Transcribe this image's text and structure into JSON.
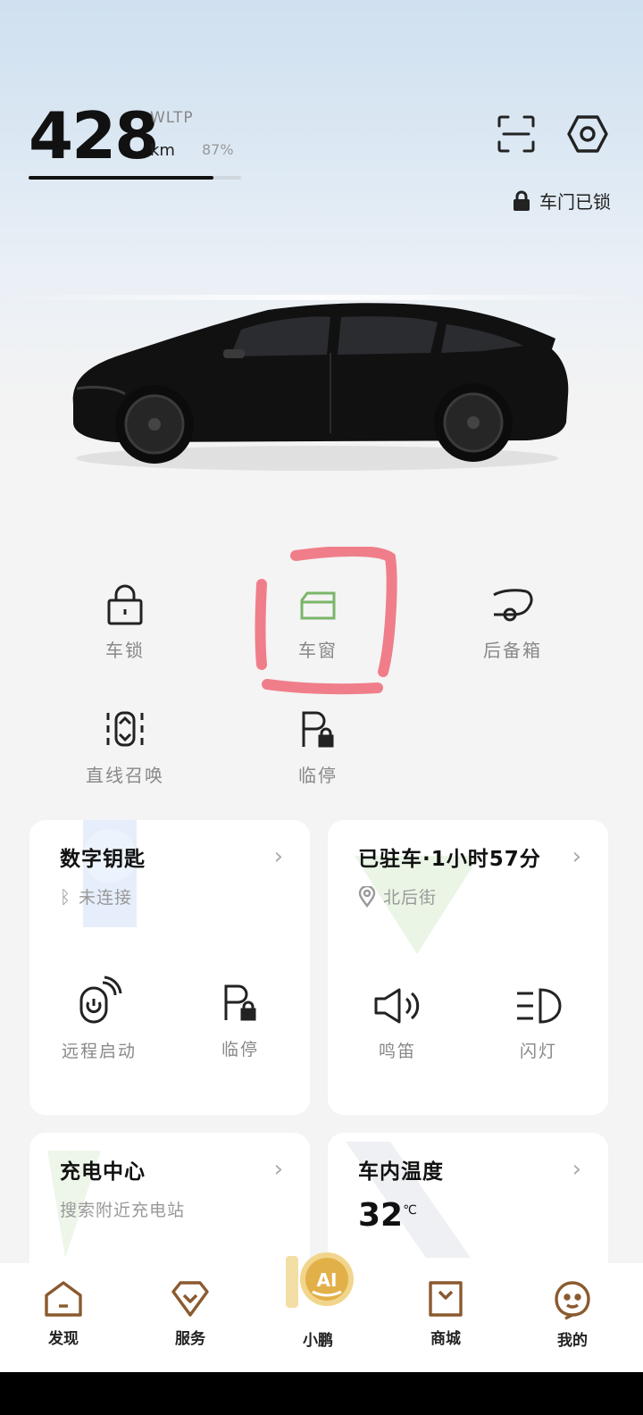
{
  "vehicle": {
    "range_value": "428",
    "range_standard": "WLTP",
    "range_unit": "km",
    "battery_percent": "87%",
    "battery_fraction": 0.87,
    "lock_status": "车门已锁"
  },
  "quick_controls": [
    {
      "label": "车锁",
      "icon": "lock-icon"
    },
    {
      "label": "车窗",
      "icon": "window-icon"
    },
    {
      "label": "后备箱",
      "icon": "trunk-icon"
    },
    {
      "label": "直线召唤",
      "icon": "summon-icon"
    },
    {
      "label": "临停",
      "icon": "parking-icon"
    }
  ],
  "cards": {
    "digital_key": {
      "title": "数字钥匙",
      "status": "未连接",
      "actions": [
        {
          "label": "远程启动",
          "icon": "remote-start-icon"
        },
        {
          "label": "临停",
          "icon": "parking-icon"
        }
      ]
    },
    "parked": {
      "title": "已驻车·1小时57分",
      "location": "北后街",
      "actions": [
        {
          "label": "鸣笛",
          "icon": "horn-icon"
        },
        {
          "label": "闪灯",
          "icon": "headlight-icon"
        }
      ]
    },
    "charging": {
      "title": "充电中心",
      "subtitle": "搜索附近充电站"
    },
    "cabin_temp": {
      "title": "车内温度",
      "value": "32",
      "unit": "℃"
    }
  },
  "tabs": [
    {
      "label": "发现",
      "icon": "home-icon"
    },
    {
      "label": "服务",
      "icon": "service-icon"
    },
    {
      "label": "小鹏",
      "icon": "ai-icon",
      "badge": "AI"
    },
    {
      "label": "商城",
      "icon": "shop-icon"
    },
    {
      "label": "我的",
      "icon": "profile-icon"
    }
  ],
  "colors": {
    "accent_green": "#7ab56a",
    "highlight_red": "#f06a78",
    "tab_brown": "#8a5a2e",
    "ai_gold": "#d9a94a"
  }
}
